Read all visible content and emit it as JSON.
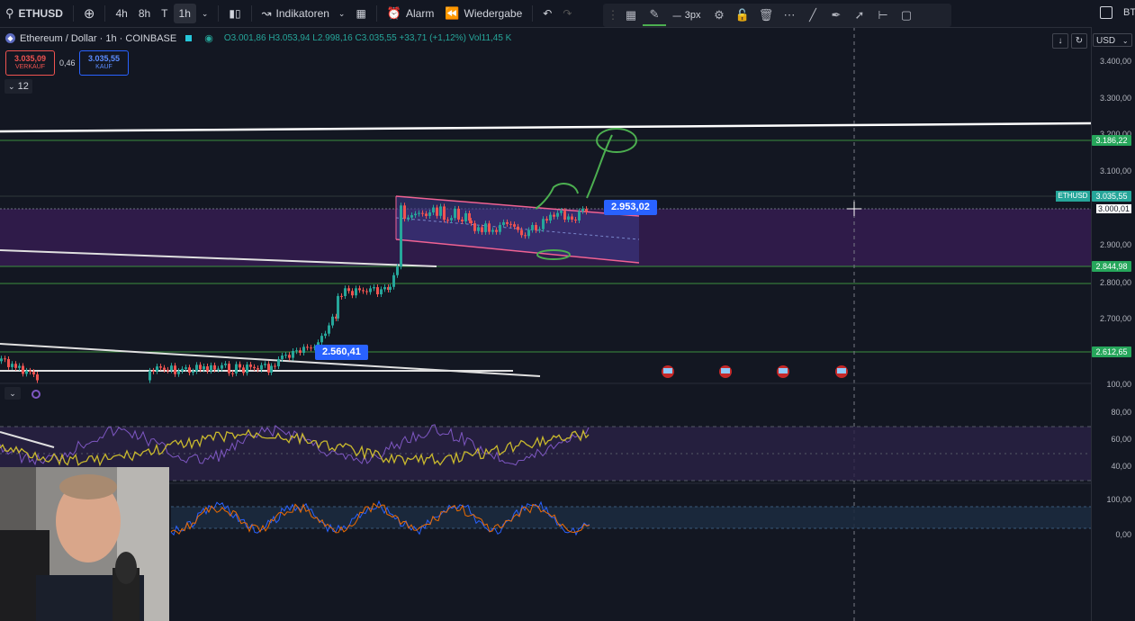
{
  "toolbar": {
    "symbol": "ETHUSD",
    "intervals": [
      "4h",
      "8h",
      "T",
      "1h"
    ],
    "active_interval": "1h",
    "indicators_label": "Indikatoren",
    "alarm_label": "Alarm",
    "replay_label": "Wiedergabe",
    "right_label": "BT"
  },
  "draw_toolbar": {
    "stroke_width": "3px"
  },
  "legend": {
    "title": "Ethereum / Dollar · 1h · COINBASE",
    "ohlc": "O3.001,86 H3.053,94 L2.998,16 C3.035,55 +33,71 (+1,12%) Vol11,45 K",
    "sell_price": "3.035,09",
    "sell_label": "VERKAUF",
    "spread": "0,46",
    "buy_price": "3.035,55",
    "buy_label": "KAUF",
    "collapsed_count": "12"
  },
  "currency": "USD",
  "price_axis": {
    "ticks": [
      "3.400,00",
      "3.300,00",
      "3.200,00",
      "3.100,00",
      "3.000,01",
      "2.900,00",
      "2.800,00",
      "2.700,00"
    ],
    "tags": [
      {
        "text": "3.186,22",
        "color": "#26a65b"
      },
      {
        "text": "3.035,55",
        "color": "#26a69a"
      },
      {
        "text": "2.844,98",
        "color": "#26a65b"
      },
      {
        "text": "2.612,65",
        "color": "#26a65b"
      }
    ],
    "symbol_tag": "ETHUSD"
  },
  "chart_labels": {
    "upper": "2.953,02",
    "lower": "2.560,41"
  },
  "indicator1_axis": [
    "100,00",
    "80,00",
    "60,00",
    "40,00"
  ],
  "indicator2_axis": [
    "100,00",
    "0,00"
  ],
  "colors": {
    "bg": "#131722",
    "up": "#26a69a",
    "down": "#ef5350",
    "accent": "#2962ff"
  }
}
